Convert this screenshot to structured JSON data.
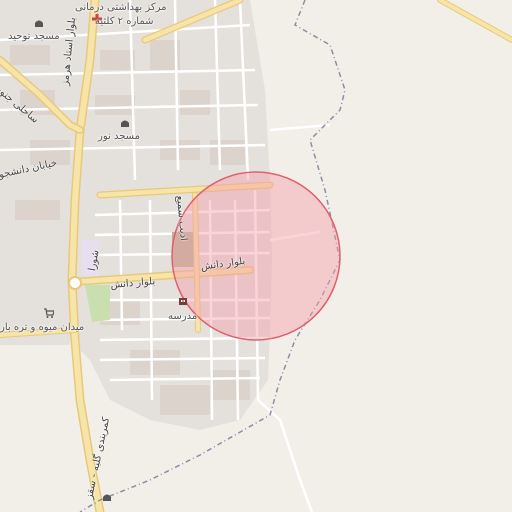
{
  "map": {
    "colors": {
      "background": "#f2efe9",
      "block": "#e4e1dc",
      "building": "#d9d0c9",
      "street": "#ffffff",
      "primary_road": "#f7e4a8",
      "primary_road_casing": "#e8c97a",
      "green": "#c9dfb0",
      "boundary": "#8a8ea6",
      "highlight_fill": "#f4a0ab",
      "highlight_stroke": "#e0606f"
    },
    "labels": {
      "health_center": "مرکز بهداشتی درمانی",
      "health_center_2": "شماره ۲ کلثیه",
      "mosque_tohid": "مسجد توحید",
      "mosque_noor": "مسجد نور",
      "blvd_ostad": "بلوار استاد هرمز",
      "sahali_jonoobi": "ساحلی جنوبی",
      "khiaban_daneshju": "خیابان دانشجو",
      "blvd_danesh_a": "بلوار دانش",
      "blvd_danesh_b": "بلوار دانش",
      "shura": "شورا",
      "adib_mirzaei": "ادیب سمیع",
      "school": "مدرسه",
      "fruit_square": "میدان میوه و تره بار",
      "kamarbandi": "کمربندی گلبه - سقز"
    },
    "icons": {
      "mosque_1": "mosque-icon",
      "mosque_2": "mosque-icon",
      "health": "health-icon",
      "school": "school-icon",
      "cart": "shopping-cart-icon",
      "bottom_poi": "poi-icon"
    }
  }
}
